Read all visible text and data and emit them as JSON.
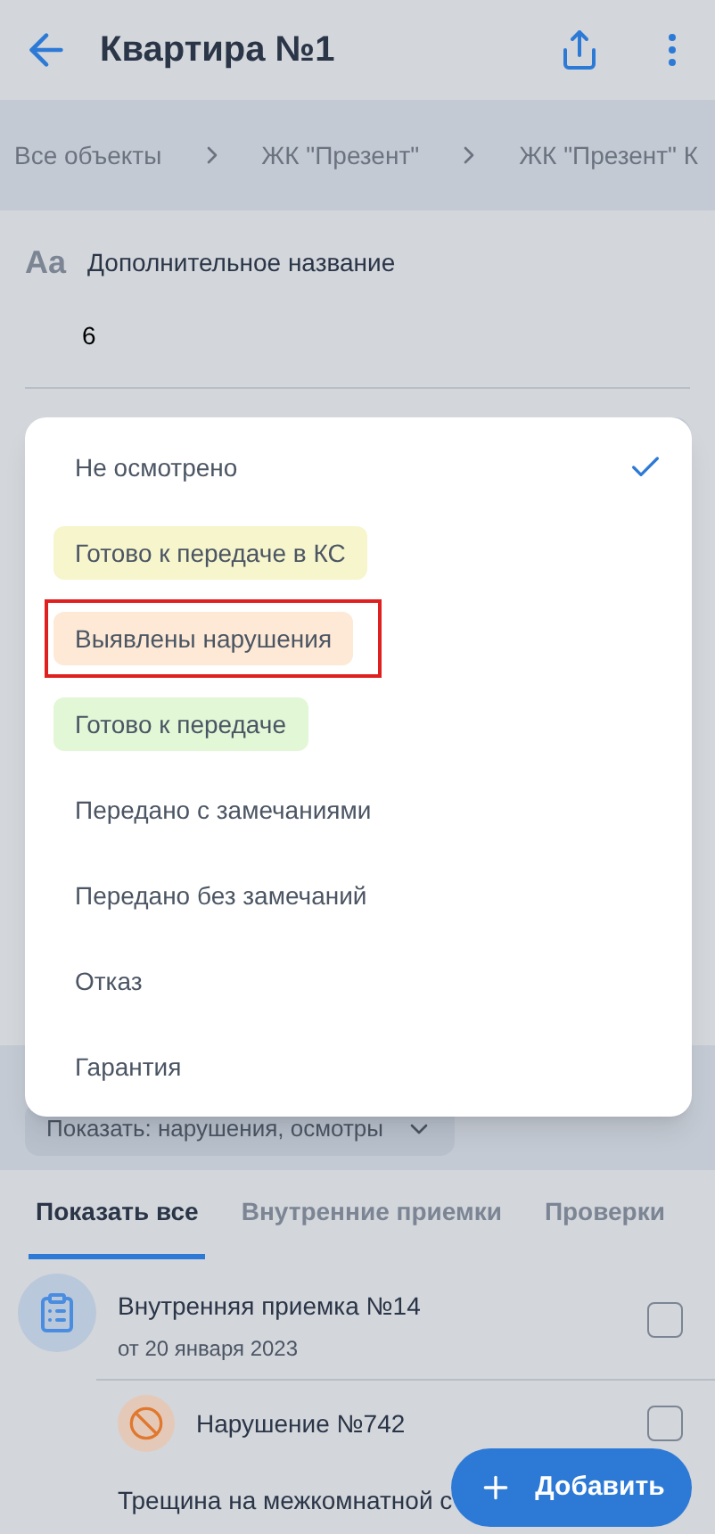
{
  "header": {
    "title": "Квартира №1"
  },
  "breadcrumbs": [
    "Все объекты",
    "ЖК \"Презент\"",
    "ЖК \"Презент\" К"
  ],
  "field": {
    "icon_text": "Aa",
    "label": "Дополнительное название",
    "value": "6"
  },
  "filter": {
    "label": "Показать: нарушения, осмотры"
  },
  "tabs": [
    {
      "label": "Показать все",
      "selected": true
    },
    {
      "label": "Внутренние приемки",
      "selected": false
    },
    {
      "label": "Проверки",
      "selected": false
    }
  ],
  "items": [
    {
      "kind": "inspection",
      "title": "Внутренняя приемка №14",
      "subtitle": "от 20 января 2023",
      "checked": false
    },
    {
      "kind": "violation",
      "title": "Нарушение №742",
      "description": "Трещина на межкомнатной с",
      "checked": false
    }
  ],
  "fab": {
    "label": "Добавить"
  },
  "status_menu": [
    {
      "label": "Не осмотрено",
      "selected": true,
      "highlighted": false
    },
    {
      "label": "Готово к передаче в КС",
      "selected": false,
      "highlighted": false,
      "color": "#f6f5cc"
    },
    {
      "label": "Выявлены нарушения",
      "selected": false,
      "highlighted": true,
      "color": "#fde9d5"
    },
    {
      "label": "Готово к передаче",
      "selected": false,
      "highlighted": false,
      "color": "#e1f7d6"
    },
    {
      "label": "Передано с замечаниями",
      "selected": false,
      "highlighted": false
    },
    {
      "label": "Передано без замечаний",
      "selected": false,
      "highlighted": false
    },
    {
      "label": "Отказ",
      "selected": false,
      "highlighted": false
    },
    {
      "label": "Гарантия",
      "selected": false,
      "highlighted": false
    }
  ]
}
